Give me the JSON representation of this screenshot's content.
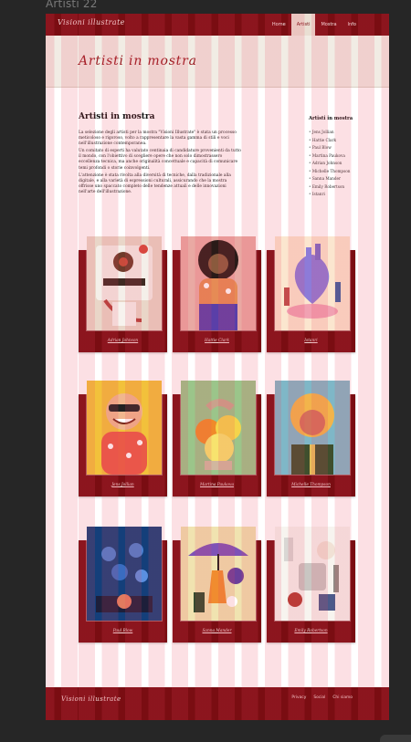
{
  "window": {
    "title": "Artisti 22"
  },
  "site": {
    "brand": "Visioni illustrate",
    "nav": [
      {
        "label": "Home",
        "active": false
      },
      {
        "label": "Artisti",
        "active": true
      },
      {
        "label": "Mostra",
        "active": false
      },
      {
        "label": "Info",
        "active": false
      }
    ]
  },
  "hero": {
    "title": "Artisti in mostra"
  },
  "main": {
    "title": "Artisti in mostra",
    "paragraphs": [
      "La selezione degli artisti per la mostra \"Visioni Illustrate\" è stata un processo meticoloso e rigoroso, volto a rappresentare la vasta gamma di stili e voci nell'illustrazione contemporanea.",
      "Un comitato di esperti ha valutato centinaia di candidature provenienti da tutto il mondo, con l'obiettivo di scegliere opere che non solo dimostrassero eccellenza tecnica, ma anche originalità concettuale e capacità di comunicare temi profondi o storie coinvolgenti.",
      "L'attenzione è stata rivolta alla diversità di tecniche, dalla tradizionale alla digitale, e alla varietà di espressioni culturali, assicurando che la mostra offrisse uno spaccato completo delle tendenze attuali e delle innovazioni nell'arte dell'illustrazione."
    ]
  },
  "sidebar": {
    "title": "Artisti in mostra",
    "items": [
      "Jens Jollian",
      "Hattie Clark",
      "Paul Blow",
      "Martina Paukova",
      "Adrian Johnson",
      "Michelle Thompson",
      "Sanna Mander",
      "Emily Robertson",
      "Istanri"
    ]
  },
  "gallery": [
    {
      "name": "Adrian Johnson"
    },
    {
      "name": "Hattie Clark"
    },
    {
      "name": "Istanri"
    },
    {
      "name": "Jens Jollian"
    },
    {
      "name": "Martina Paukova"
    },
    {
      "name": "Michelle Thompson"
    },
    {
      "name": "Paul Blow"
    },
    {
      "name": "Sanna Mander"
    },
    {
      "name": "Emily Robertson"
    }
  ],
  "footer": {
    "brand": "Visioni illustrate",
    "links": [
      "Privacy",
      "Social",
      "Chi siamo"
    ]
  },
  "colors": {
    "primary": "#7a0d12",
    "hero_bg": "#f1ece4",
    "accent_text": "#9a1a20"
  }
}
